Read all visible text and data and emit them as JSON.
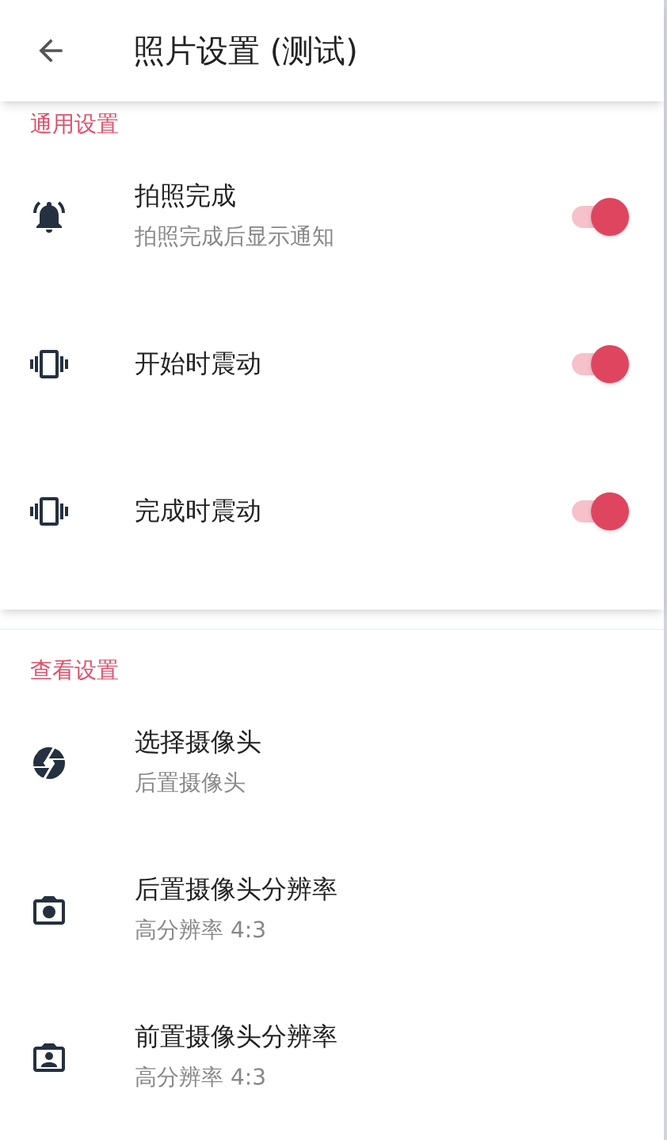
{
  "app_bar": {
    "title": "照片设置 (测试)"
  },
  "sections": [
    {
      "title": "通用设置",
      "items": [
        {
          "kind": "switch",
          "title": "拍照完成",
          "summary": "拍照完成后显示通知",
          "on": true
        },
        {
          "kind": "switch",
          "title": "开始时震动",
          "on": true
        },
        {
          "kind": "switch",
          "title": "完成时震动",
          "on": true
        }
      ]
    },
    {
      "title": "查看设置",
      "items": [
        {
          "kind": "option",
          "title": "选择摄像头",
          "summary": "后置摄像头"
        },
        {
          "kind": "option",
          "title": "后置摄像头分辨率",
          "summary": "高分辨率 4:3"
        },
        {
          "kind": "option",
          "title": "前置摄像头分辨率",
          "summary": "高分辨率 4:3"
        }
      ]
    }
  ]
}
